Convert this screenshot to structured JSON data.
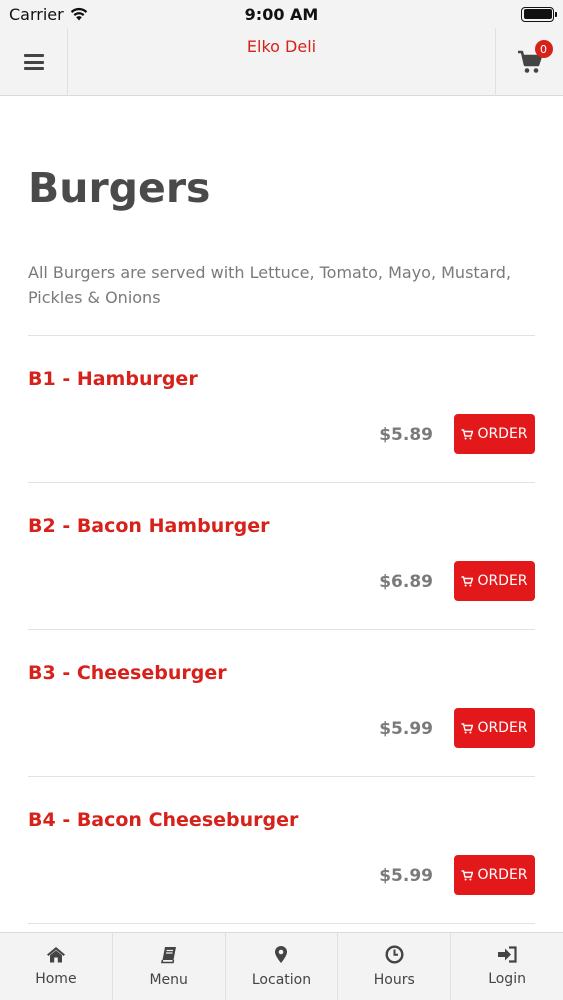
{
  "status_bar": {
    "carrier": "Carrier",
    "time": "9:00 AM"
  },
  "navbar": {
    "title": "Elko Deli",
    "cart_count": "0"
  },
  "page": {
    "title": "Burgers",
    "description": "All Burgers are served with Lettuce, Tomato, Mayo, Mustard, Pickles & Onions"
  },
  "items": [
    {
      "name": "B1 - Hamburger",
      "price": "$5.89",
      "order_label": "ORDER"
    },
    {
      "name": "B2 - Bacon Hamburger",
      "price": "$6.89",
      "order_label": "ORDER"
    },
    {
      "name": "B3 - Cheeseburger",
      "price": "$5.99",
      "order_label": "ORDER"
    },
    {
      "name": "B4 - Bacon Cheeseburger",
      "price": "$5.99",
      "order_label": "ORDER"
    }
  ],
  "tabs": [
    {
      "label": "Home",
      "icon": "home-icon"
    },
    {
      "label": "Menu",
      "icon": "book-icon"
    },
    {
      "label": "Location",
      "icon": "map-pin-icon"
    },
    {
      "label": "Hours",
      "icon": "clock-icon"
    },
    {
      "label": "Login",
      "icon": "sign-in-icon"
    }
  ],
  "colors": {
    "accent": "#d7211b",
    "button": "#e2181b",
    "bar_bg": "#f4f3f3"
  }
}
